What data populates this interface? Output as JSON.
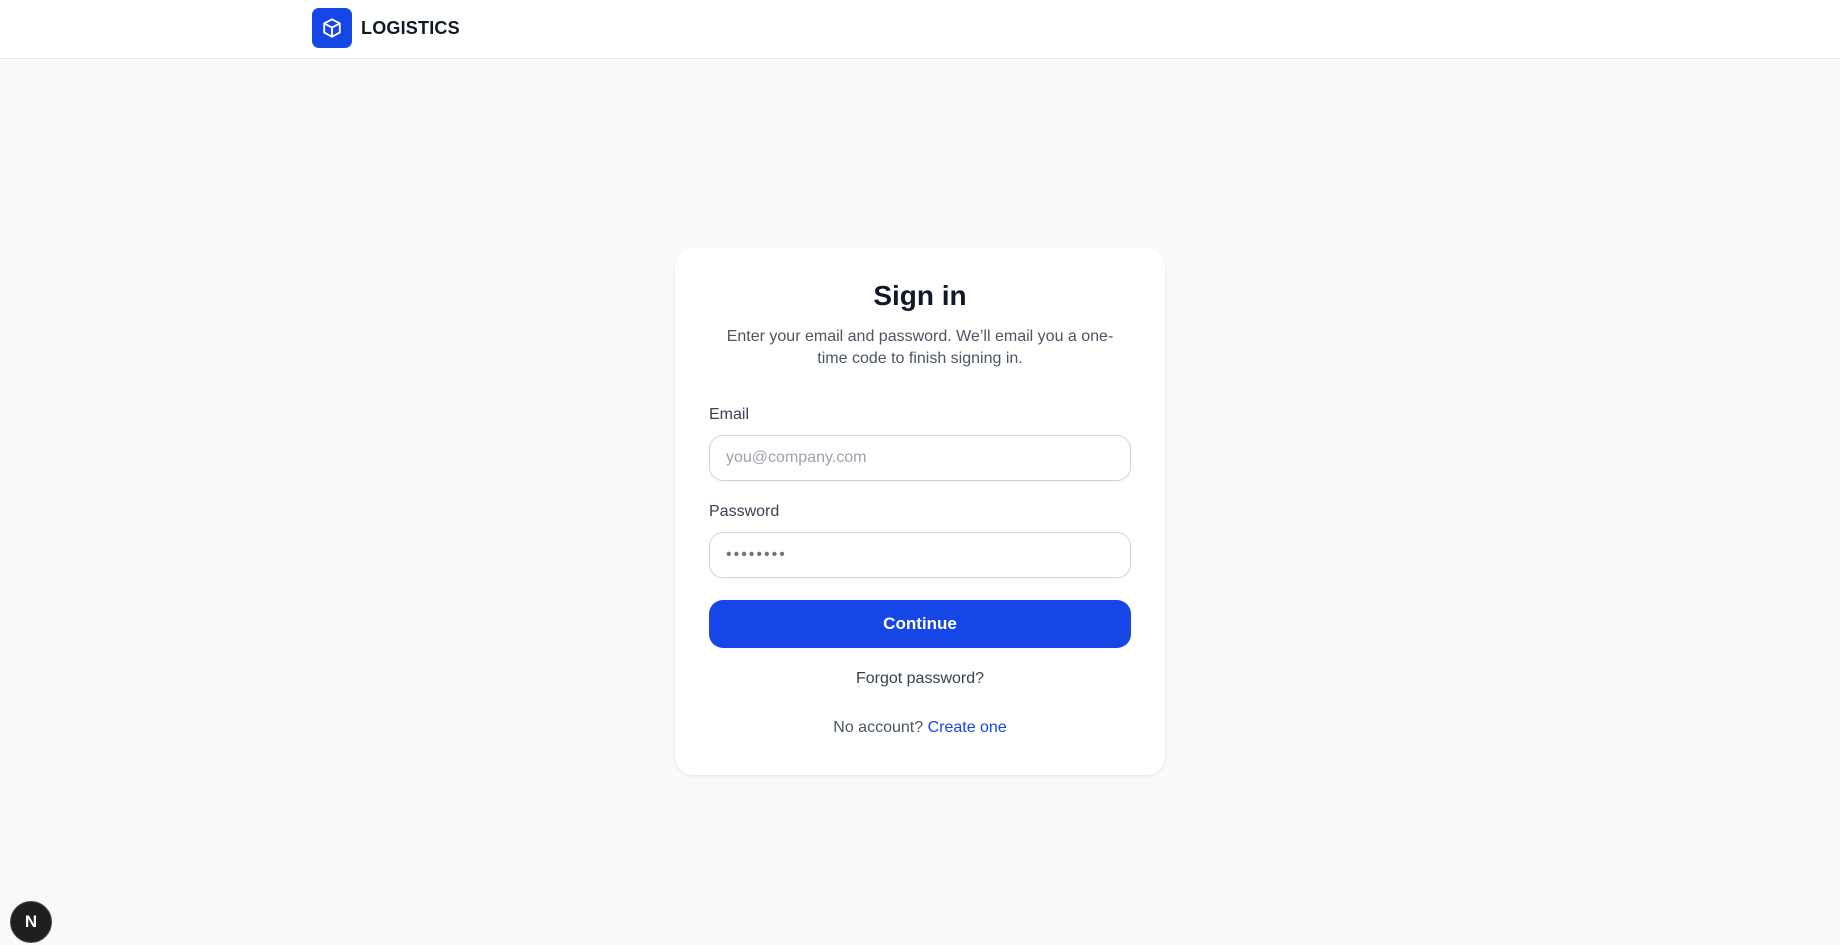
{
  "header": {
    "brand_name": "LOGISTICS",
    "brand_icon": "cube-icon",
    "brand_color": "#1547e6"
  },
  "signin": {
    "title": "Sign in",
    "subtitle": "Enter your email and password. We’ll email you a one-time code to finish signing in.",
    "email_label": "Email",
    "email_placeholder": "you@company.com",
    "email_value": "",
    "password_label": "Password",
    "password_placeholder": "••••••••",
    "password_value": "",
    "continue_label": "Continue",
    "forgot_label": "Forgot password?",
    "no_account_text": "No account?",
    "create_label": "Create one"
  },
  "dev_badge": {
    "label": "N",
    "icon": "nextjs-icon"
  },
  "colors": {
    "accent": "#1547e6",
    "background": "#f8f9fb",
    "card": "#ffffff"
  }
}
